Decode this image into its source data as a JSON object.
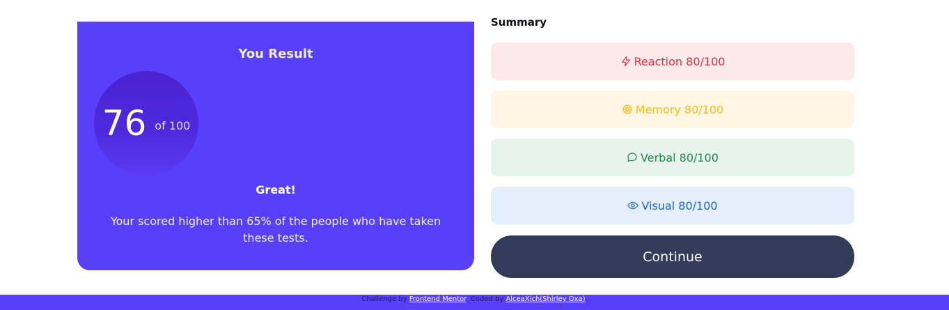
{
  "result": {
    "title": "You Result",
    "score": "76",
    "score_of": "of 100",
    "label": "Great!",
    "description": "Your scored higher than 65% of the people who have taken these tests."
  },
  "summary": {
    "title": "Summary",
    "items": [
      {
        "icon": "lightning-icon",
        "label": "Reaction 80/100",
        "color": "#e0313d",
        "bg": "#fce9ea"
      },
      {
        "icon": "brain-icon",
        "label": "Memory 80/100",
        "color": "#f7bb1b",
        "bg": "#fff7e3"
      },
      {
        "icon": "chat-bubble-icon",
        "label": "Verbal 80/100",
        "color": "#1b8b4a",
        "bg": "#e6f4ec"
      },
      {
        "icon": "eye-icon",
        "label": "Visual 80/100",
        "color": "#1c65d1",
        "bg": "#e5effc"
      }
    ],
    "continue_label": "Continue"
  },
  "footer": {
    "prefix": "Challenge by ",
    "link1": "Frontend Mentor",
    "middle": ". Coded by ",
    "link2": "AlceaXich(Shirley Oxa)",
    "suffix": "."
  },
  "colors": {
    "accent": "#583ffb",
    "button": "#323c59"
  }
}
